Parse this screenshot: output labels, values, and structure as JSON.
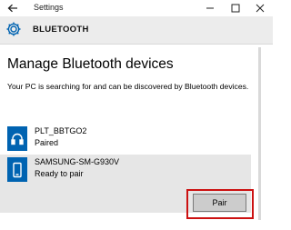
{
  "window": {
    "title": "Settings",
    "back_icon": "back-arrow-icon",
    "controls": [
      "minimize-icon",
      "maximize-icon",
      "close-icon"
    ]
  },
  "header": {
    "icon": "gear-icon",
    "title": "BLUETOOTH"
  },
  "main": {
    "title": "Manage Bluetooth devices",
    "description": "Your PC is searching for and can be discovered by Bluetooth devices."
  },
  "devices": [
    {
      "name": "PLT_BBTGO2",
      "status": "Paired",
      "icon": "headset-icon"
    },
    {
      "name": "SAMSUNG-SM-G930V",
      "status": "Ready to pair",
      "icon": "phone-icon"
    }
  ],
  "actions": {
    "pair_label": "Pair"
  },
  "colors": {
    "accent": "#0063b1",
    "selected_row": "#e6e6e6",
    "header_bg": "#ececec",
    "highlight": "#cc1111"
  }
}
